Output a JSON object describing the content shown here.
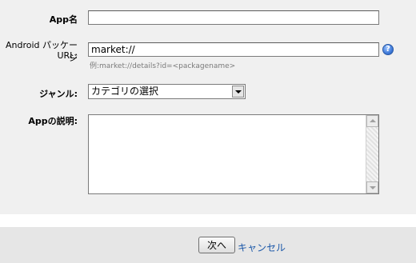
{
  "form": {
    "app_name": {
      "label": "App名",
      "value": ""
    },
    "package_url": {
      "label_line1": "Android パッケージ",
      "label_line2": "URL:",
      "value": "market://",
      "example": "例:market://details?id=<packagename>",
      "help_icon": "question-icon",
      "help_glyph": "?"
    },
    "genre": {
      "label": "ジャンル:",
      "selected": "カテゴリの選択"
    },
    "description": {
      "label": "Appの説明:",
      "value": ""
    }
  },
  "footer": {
    "next_label": "次へ",
    "cancel_label": "キャンセル"
  },
  "colors": {
    "background": "#f0f0f0",
    "footer_background": "#e6e6e6",
    "link": "#1a57a8",
    "help_icon": "#3f7ad9"
  }
}
